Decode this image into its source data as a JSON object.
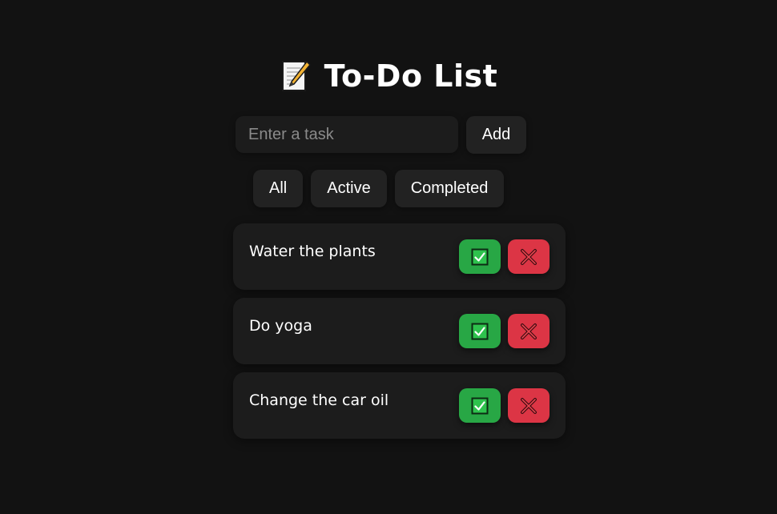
{
  "header": {
    "title": "To-Do List",
    "icon": "memo-icon"
  },
  "input": {
    "placeholder": "Enter a task",
    "value": "",
    "add_label": "Add"
  },
  "filters": [
    {
      "label": "All"
    },
    {
      "label": "Active"
    },
    {
      "label": "Completed"
    }
  ],
  "tasks": [
    {
      "text": "Water the plants"
    },
    {
      "text": "Do yoga"
    },
    {
      "text": "Change the car oil"
    }
  ],
  "actions": {
    "complete_icon": "check-box-icon",
    "delete_icon": "cross-icon"
  },
  "colors": {
    "background": "#121212",
    "card": "#1c1c1c",
    "button": "#222222",
    "complete": "#28a745",
    "delete": "#dc3545"
  }
}
